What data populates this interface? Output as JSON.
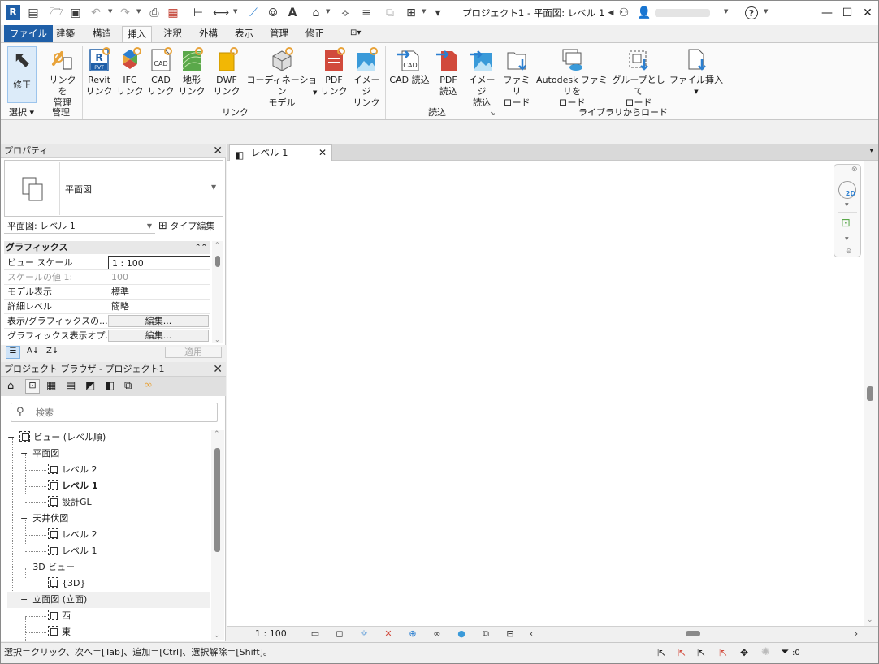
{
  "title": {
    "app_badge": "R",
    "window_title": "プロジェクト1 - 平面図: レベル 1"
  },
  "tabs": [
    "ファイル",
    "建築",
    "構造",
    "挿入",
    "注釈",
    "外構",
    "表示",
    "管理",
    "修正"
  ],
  "active_tab": "挿入",
  "ribbon": {
    "modify": "修正",
    "select_label": "選択",
    "link_manage": [
      "リンクを",
      "管理"
    ],
    "manage_label": "管理",
    "revit_link": [
      "Revit",
      "リンク"
    ],
    "ifc_link": [
      "IFC",
      "リンク"
    ],
    "cad_link": [
      "CAD",
      "リンク"
    ],
    "terrain_link": [
      "地形",
      "リンク"
    ],
    "dwf_link": [
      "DWF",
      "リンク"
    ],
    "coordination_model": [
      "コーディネーション",
      "モデル"
    ],
    "pdf_link": [
      "PDF",
      "リンク"
    ],
    "image_link": [
      "イメージ",
      "リンク"
    ],
    "link_panel_label": "リンク",
    "cad_import": "CAD 読込",
    "pdf_import": [
      "PDF",
      "読込"
    ],
    "image_import": [
      "イメージ",
      "読込"
    ],
    "import_panel_label": "読込",
    "family_load": [
      "ファミリ",
      "ロード"
    ],
    "autodesk_family": [
      "Autodesk ファミリを",
      "ロード"
    ],
    "group_load": [
      "グループとして",
      "ロード"
    ],
    "file_insert": "ファイル挿入",
    "library_panel_label": "ライブラリからロード",
    "cad_icon_text": "CAD",
    "rvt_icon_text": "RVT"
  },
  "properties": {
    "title": "プロパティ",
    "type_name": "平面図",
    "view_selector": "平面図: レベル 1",
    "type_edit": "タイプ編集",
    "section": "グラフィックス",
    "rows": [
      {
        "key": "ビュー スケール",
        "value": "1 : 100"
      },
      {
        "key": "スケールの値",
        "key_suffix": "1:",
        "value": "100"
      },
      {
        "key": "モデル表示",
        "value": "標準"
      },
      {
        "key": "詳細レベル",
        "value": "簡略"
      },
      {
        "key": "表示/グラフィックスの...",
        "value": "編集..."
      },
      {
        "key": "グラフィックス表示オプ...",
        "value": "編集..."
      }
    ],
    "apply": "適用"
  },
  "browser": {
    "title": "プロジェクト ブラウザ - プロジェクト1",
    "search_placeholder": "検索",
    "tree": {
      "root": "ビュー (レベル順)",
      "floor_plans": "平面図",
      "fp_items": [
        "レベル 2",
        "レベル 1",
        "設計GL"
      ],
      "ceiling_plans": "天井伏図",
      "cp_items": [
        "レベル 2",
        "レベル 1"
      ],
      "views_3d": "3D ビュー",
      "v3d_items": [
        "{3D}"
      ],
      "elevations": "立面図 (立面)",
      "el_items": [
        "西",
        "東"
      ]
    }
  },
  "canvas": {
    "tab_label": "レベル 1",
    "scale": "1 : 100"
  },
  "status": {
    "hint": "選択＝クリック、次へ＝[Tab]、追加＝[Ctrl]、選択解除＝[Shift]。",
    "filter_count": ":0"
  },
  "colors": {
    "file_tab": "#1f5fa8",
    "accent_blue": "#2b7fd0",
    "link_orange": "#e8a33a",
    "pdf_red": "#d14a3c"
  }
}
